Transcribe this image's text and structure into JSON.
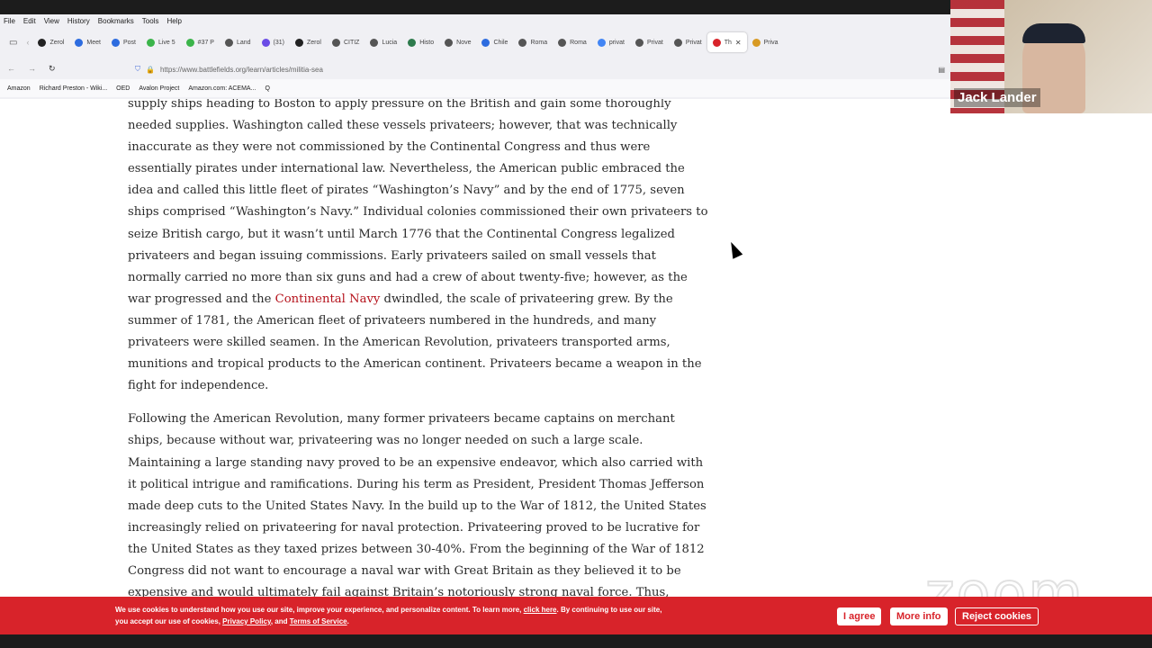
{
  "menu": [
    "File",
    "Edit",
    "View",
    "History",
    "Bookmarks",
    "Tools",
    "Help"
  ],
  "tabs": [
    {
      "label": "Zerol",
      "color": "#222"
    },
    {
      "label": "Meet",
      "color": "#2d6cdf"
    },
    {
      "label": "Post",
      "color": "#2d6cdf"
    },
    {
      "label": "Live 5",
      "color": "#3bb44a"
    },
    {
      "label": "#37 P",
      "color": "#3bb44a"
    },
    {
      "label": "Land",
      "color": "#555"
    },
    {
      "label": "(31)",
      "color": "#6b4ce6"
    },
    {
      "label": "Zerol",
      "color": "#222"
    },
    {
      "label": "CITIZ",
      "color": "#555"
    },
    {
      "label": "Lucia",
      "color": "#555"
    },
    {
      "label": "Histo",
      "color": "#2d7a4c"
    },
    {
      "label": "Nove",
      "color": "#555"
    },
    {
      "label": "Chile",
      "color": "#2d6cdf"
    },
    {
      "label": "Roma",
      "color": "#555"
    },
    {
      "label": "Roma",
      "color": "#555"
    },
    {
      "label": "privat",
      "color": "#4285f4"
    },
    {
      "label": "Privat",
      "color": "#555"
    },
    {
      "label": "Privat",
      "color": "#555"
    },
    {
      "label": "Th",
      "color": "#d8232a",
      "active": true
    },
    {
      "label": "Priva",
      "color": "#d89a23"
    }
  ],
  "url": "https://www.battlefields.org/learn/articles/militia-sea",
  "bookmarks": [
    "Amazon",
    "Richard Preston - Wiki...",
    "OED",
    "Avalon Project",
    "Amazon.com: ACEMA...",
    "Q"
  ],
  "article": {
    "p1_a": "supply ships heading to Boston to apply pressure on the British and gain some thoroughly needed supplies. Washington called these vessels privateers; however, that was technically inaccurate as they were not commissioned by the Continental Congress and thus were essentially pirates under international law. Nevertheless, the American public embraced the idea and called this little fleet of pirates “Washington’s Navy” and by the end of 1775, seven ships comprised “Washington’s Navy.” Individual colonies commissioned their own privateers to seize British cargo, but it wasn’t until March 1776 that the Continental Congress legalized privateers and began issuing commissions. Early privateers sailed on small vessels that normally carried no more than six guns and had a crew of about twenty-five; however, as the war progressed and the ",
    "p1_link": "Continental Navy",
    "p1_b": " dwindled, the scale of privateering grew. By the summer of 1781, the American fleet of privateers numbered in the hundreds, and many privateers were skilled seamen. In the American Revolution, privateers transported arms, munitions and tropical products to the American continent. Privateers became a weapon in the fight for independence.",
    "p2": "Following the American Revolution, many former privateers became captains on merchant ships, because without war, privateering was no longer needed on such a large scale. Maintaining a large standing navy proved to be an expensive endeavor, which also carried with it political intrigue and ramifications. During his term as President, President Thomas Jefferson made deep cuts to the United States Navy. In the build up to the War of 1812, the United States increasingly relied on privateering for naval protection. Privateering proved to be lucrative for the United States as they taxed prizes between 30-40%. From the beginning of the War of 1812 Congress did not want to encourage a naval war with Great Britain as they believed it to be expensive and would ultimately fail against Britain’s notoriously strong naval force. Thus, Congress adopted privateering as their main naval strategy, while maintaining a small navy. By the end of the war, Congress commissioned over"
  },
  "video": {
    "name": "Jack Lander"
  },
  "zoom_watermark": "zoom",
  "cookie": {
    "text1": "We use cookies to understand how you use our site, improve your experience, and personalize content. To learn more, ",
    "click_here": "click here",
    "text2": ". By continuing to use our site,",
    "text3": "you accept our use of cookies, ",
    "privacy": "Privacy Policy",
    "and": ", and ",
    "terms": "Terms of Service",
    "end": ".",
    "agree": "I agree",
    "more": "More info",
    "reject": "Reject cookies"
  }
}
